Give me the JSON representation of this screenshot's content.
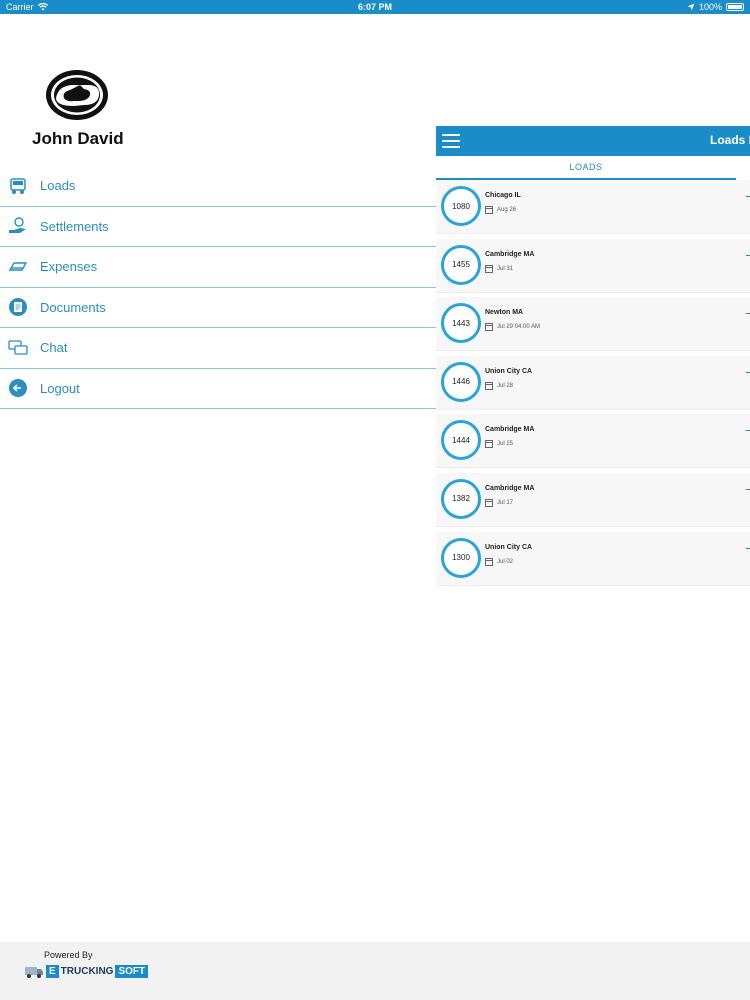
{
  "status_bar": {
    "carrier": "Carrier",
    "time": "6:07 PM",
    "battery": "100%"
  },
  "user": {
    "name": "John David"
  },
  "menu": [
    {
      "label": "Loads",
      "icon": "truck-icon"
    },
    {
      "label": "Settlements",
      "icon": "money-hand-icon"
    },
    {
      "label": "Expenses",
      "icon": "card-icon"
    },
    {
      "label": "Documents",
      "icon": "document-icon"
    },
    {
      "label": "Chat",
      "icon": "chat-icon"
    },
    {
      "label": "Logout",
      "icon": "logout-icon"
    }
  ],
  "footer": {
    "powered_by": "Powered By",
    "brand_e": "E",
    "brand_mid": "TRUCKING",
    "brand_soft": "SOFT"
  },
  "loads_panel": {
    "title": "Loads L",
    "tab": "LOADS",
    "cards": [
      {
        "id": "1080",
        "city": "Chicago IL",
        "date": "Aug 26"
      },
      {
        "id": "1455",
        "city": "Cambridge MA",
        "date": "Jul 31"
      },
      {
        "id": "1443",
        "city": "Newton MA",
        "date": "Jul 29 04:00 AM"
      },
      {
        "id": "1446",
        "city": "Union City CA",
        "date": "Jul 28"
      },
      {
        "id": "1444",
        "city": "Cambridge MA",
        "date": "Jul 25"
      },
      {
        "id": "1382",
        "city": "Cambridge MA",
        "date": "Jul 17"
      },
      {
        "id": "1300",
        "city": "Union City CA",
        "date": "Jul 02"
      }
    ]
  },
  "colors": {
    "accent": "#1a8dc8",
    "menu_text": "#2a8fbe",
    "divider": "#8fc3da"
  }
}
